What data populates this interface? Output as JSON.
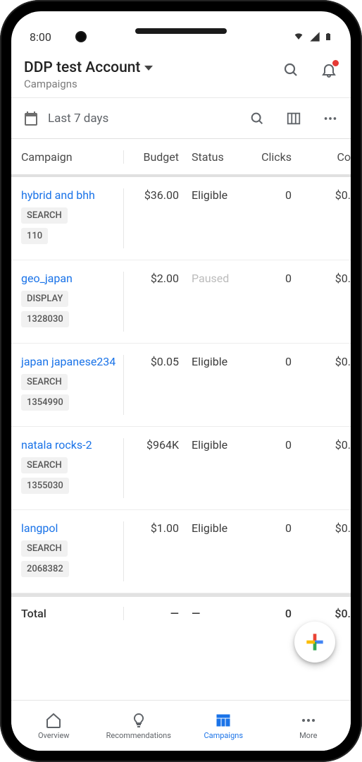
{
  "status": {
    "time": "8:00"
  },
  "header": {
    "account": "DDP test Account",
    "subtitle": "Campaigns"
  },
  "toolbar": {
    "dateRange": "Last 7 days"
  },
  "table": {
    "headers": {
      "campaign": "Campaign",
      "budget": "Budget",
      "status": "Status",
      "clicks": "Clicks",
      "cost": "Co"
    },
    "rows": [
      {
        "name": "hybrid and bhh",
        "type": "SEARCH",
        "id": "110",
        "budget": "$36.00",
        "status": "Eligible",
        "clicks": "0",
        "cost": "$0."
      },
      {
        "name": "geo_japan",
        "type": "DISPLAY",
        "id": "1328030",
        "budget": "$2.00",
        "status": "Paused",
        "clicks": "0",
        "cost": "$0."
      },
      {
        "name": "japan japanese234",
        "type": "SEARCH",
        "id": "1354990",
        "budget": "$0.05",
        "status": "Eligible",
        "clicks": "0",
        "cost": "$0."
      },
      {
        "name": "natala rocks-2",
        "type": "SEARCH",
        "id": "1355030",
        "budget": "$964K",
        "status": "Eligible",
        "clicks": "0",
        "cost": "$0."
      },
      {
        "name": "langpol",
        "type": "SEARCH",
        "id": "2068382",
        "budget": "$1.00",
        "status": "Eligible",
        "clicks": "0",
        "cost": "$0."
      }
    ],
    "total": {
      "label": "Total",
      "budget": "—",
      "status": "—",
      "clicks": "0",
      "cost": "$0."
    }
  },
  "nav": {
    "overview": "Overview",
    "recommendations": "Recommendations",
    "campaigns": "Campaigns",
    "more": "More"
  }
}
